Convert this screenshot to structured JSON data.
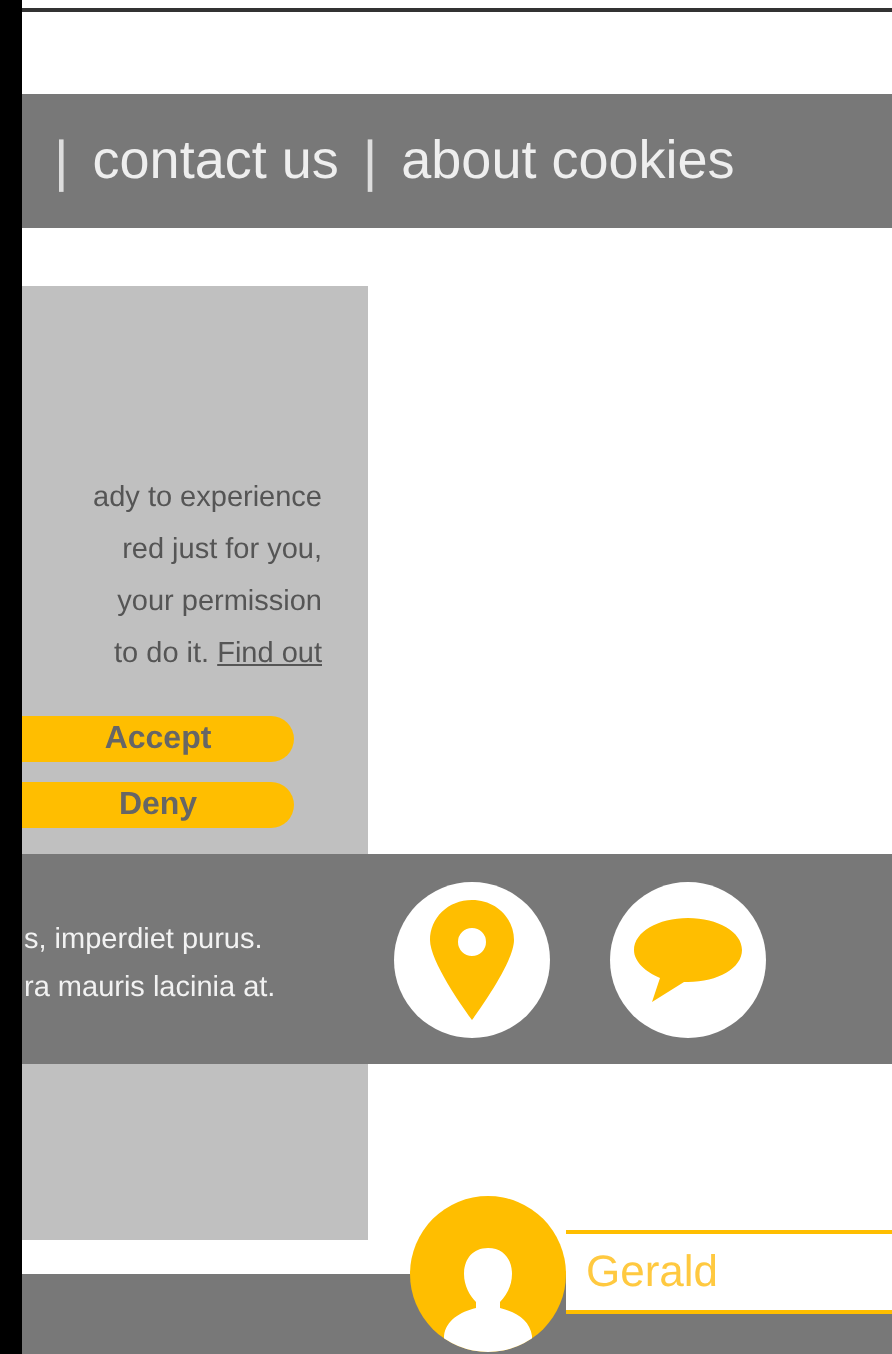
{
  "nav": [
    {
      "separator": "|",
      "label": "contact us"
    },
    {
      "separator": "|",
      "label": "about cookies"
    }
  ],
  "cookie_notice": {
    "lines": [
      "ady to experience",
      "red just for you,",
      "your permission",
      "to do it."
    ],
    "link": "Find out",
    "buttons": [
      "Accept",
      "Deny"
    ]
  },
  "info_band": {
    "lines": [
      "s, imperdiet purus.",
      "ra mauris lacinia at."
    ],
    "icons": [
      {
        "kind": "location"
      },
      {
        "kind": "chat"
      }
    ]
  },
  "user": {
    "name": "Gerald"
  }
}
